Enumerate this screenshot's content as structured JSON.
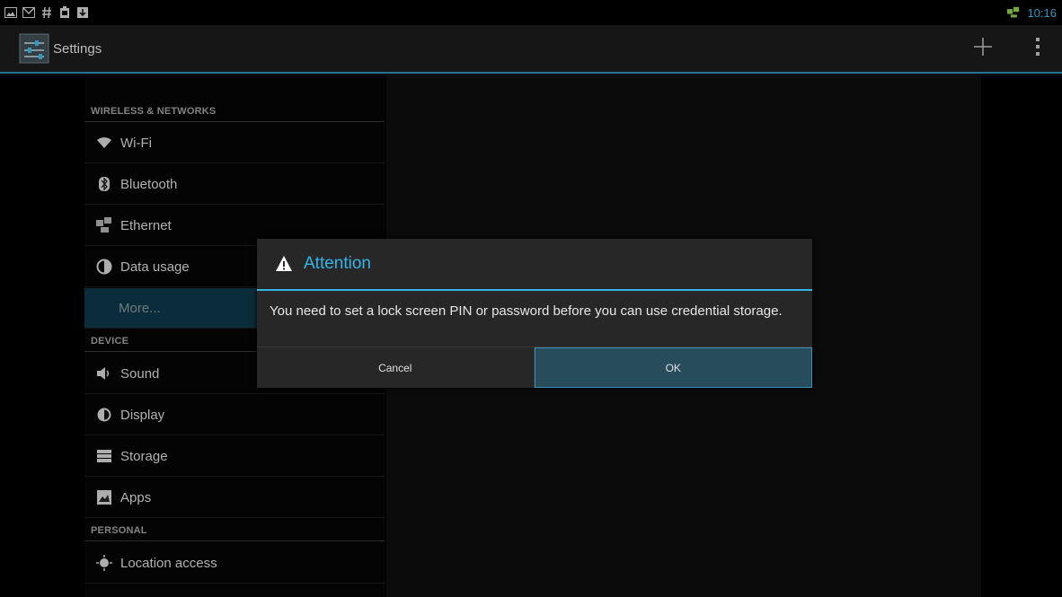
{
  "status_bar": {
    "left_icons": [
      "gallery-icon",
      "gmail-icon",
      "hash-icon",
      "clipboard-icon",
      "download-icon"
    ],
    "network_icon": "ethernet-status-icon",
    "time": "10:16"
  },
  "action_bar": {
    "title": "Settings",
    "add_icon": "plus-icon",
    "overflow_icon": "overflow-menu-icon"
  },
  "sidebar": {
    "sections": [
      {
        "header": "WIRELESS & NETWORKS",
        "items": [
          {
            "label": "Wi-Fi",
            "icon": "wifi-icon"
          },
          {
            "label": "Bluetooth",
            "icon": "bluetooth-icon"
          },
          {
            "label": "Ethernet",
            "icon": "ethernet-icon"
          },
          {
            "label": "Data usage",
            "icon": "data-usage-icon"
          },
          {
            "label": "More...",
            "icon": "",
            "selected": true
          }
        ]
      },
      {
        "header": "DEVICE",
        "items": [
          {
            "label": "Sound",
            "icon": "sound-icon"
          },
          {
            "label": "Display",
            "icon": "display-icon"
          },
          {
            "label": "Storage",
            "icon": "storage-icon"
          },
          {
            "label": "Apps",
            "icon": "apps-icon"
          }
        ]
      },
      {
        "header": "PERSONAL",
        "items": [
          {
            "label": "Location access",
            "icon": "location-icon"
          }
        ]
      }
    ]
  },
  "dialog": {
    "title": "Attention",
    "icon": "warning-icon",
    "message": "You need to set a lock screen PIN or password before you can use credential storage.",
    "cancel_label": "Cancel",
    "ok_label": "OK"
  },
  "colors": {
    "accent": "#33b5e5",
    "selected_item": "#0e3646",
    "ok_button": "#274d5c"
  }
}
